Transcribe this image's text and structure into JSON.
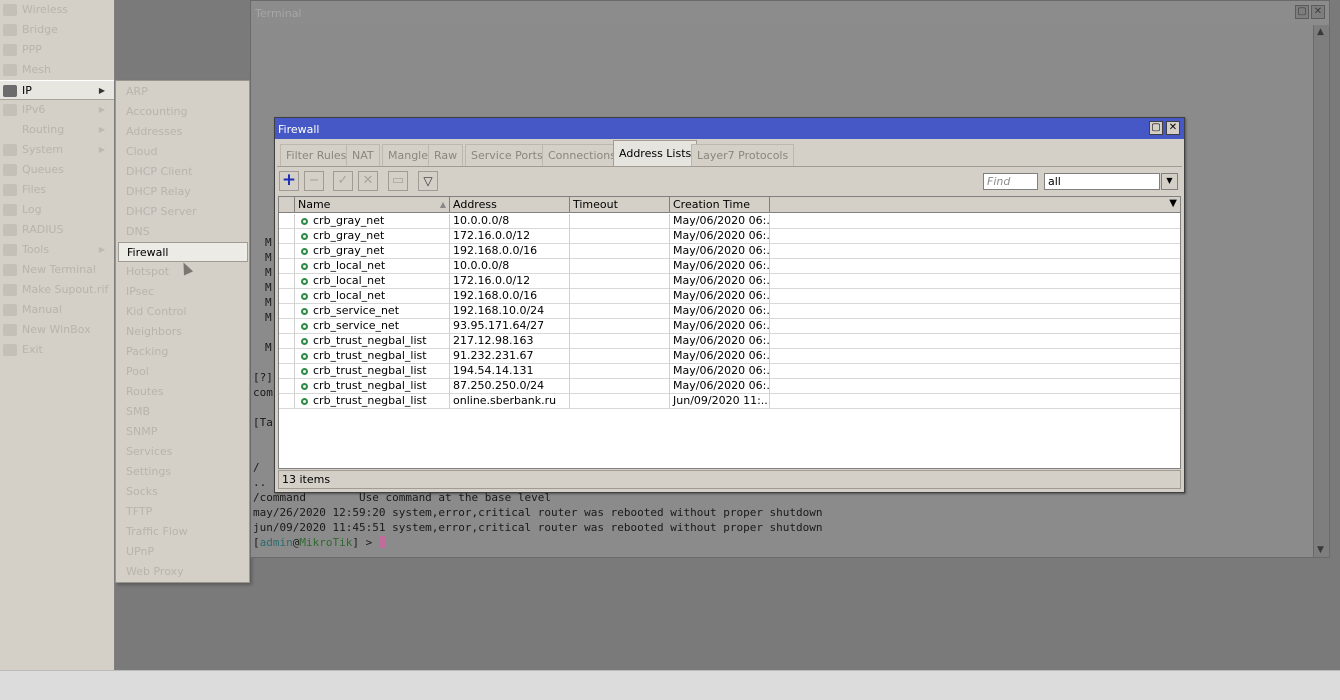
{
  "sidebar": {
    "items": [
      {
        "label": "Wireless",
        "icon": "wireless-icon",
        "arrow": false,
        "active": false
      },
      {
        "label": "Bridge",
        "icon": "bridge-icon",
        "arrow": false,
        "active": false
      },
      {
        "label": "PPP",
        "icon": "ppp-icon",
        "arrow": false,
        "active": false
      },
      {
        "label": "Mesh",
        "icon": "mesh-icon",
        "arrow": false,
        "active": false
      },
      {
        "label": "IP",
        "icon": "ip-icon",
        "arrow": true,
        "active": true
      },
      {
        "label": "IPv6",
        "icon": "ipv6-icon",
        "arrow": true,
        "active": false
      },
      {
        "label": "Routing",
        "icon": "",
        "arrow": true,
        "active": false
      },
      {
        "label": "System",
        "icon": "system-icon",
        "arrow": true,
        "active": false
      },
      {
        "label": "Queues",
        "icon": "queues-icon",
        "arrow": false,
        "active": false
      },
      {
        "label": "Files",
        "icon": "files-icon",
        "arrow": false,
        "active": false
      },
      {
        "label": "Log",
        "icon": "log-icon",
        "arrow": false,
        "active": false
      },
      {
        "label": "RADIUS",
        "icon": "radius-icon",
        "arrow": false,
        "active": false
      },
      {
        "label": "Tools",
        "icon": "tools-icon",
        "arrow": true,
        "active": false
      },
      {
        "label": "New Terminal",
        "icon": "terminal-icon",
        "arrow": false,
        "active": false
      },
      {
        "label": "Make Supout.rif",
        "icon": "supout-icon",
        "arrow": false,
        "active": false
      },
      {
        "label": "Manual",
        "icon": "manual-icon",
        "arrow": false,
        "active": false
      },
      {
        "label": "New WinBox",
        "icon": "winbox-icon",
        "arrow": false,
        "active": false
      },
      {
        "label": "Exit",
        "icon": "exit-icon",
        "arrow": false,
        "active": false
      }
    ]
  },
  "submenu": {
    "items": [
      "ARP",
      "Accounting",
      "Addresses",
      "Cloud",
      "DHCP Client",
      "DHCP Relay",
      "DHCP Server",
      "DNS",
      "Firewall",
      "Hotspot",
      "IPsec",
      "Kid Control",
      "Neighbors",
      "Packing",
      "Pool",
      "Routes",
      "SMB",
      "SNMP",
      "Services",
      "Settings",
      "Socks",
      "TFTP",
      "Traffic Flow",
      "UPnP",
      "Web Proxy"
    ],
    "active": "Firewall"
  },
  "terminal": {
    "title": "Terminal",
    "side_chars": [
      "M",
      "M",
      "M",
      "M",
      "M",
      "M",
      "M"
    ],
    "fragments": [
      "[?]",
      "com",
      "[Ta",
      "/",
      ".."
    ],
    "lines": [
      "/command        Use command at the base level",
      "may/26/2020 12:59:20 system,error,critical router was rebooted without proper shutdown",
      "jun/09/2020 11:45:51 system,error,critical router was rebooted without proper shutdown"
    ],
    "prompt": {
      "open": "[",
      "user": "admin",
      "at": "@",
      "host": "MikroTik",
      "close": "] > "
    }
  },
  "firewall": {
    "title": "Firewall",
    "tabs": [
      "Filter Rules",
      "NAT",
      "Mangle",
      "Raw",
      "Service Ports",
      "Connections",
      "Address Lists",
      "Layer7 Protocols"
    ],
    "active_tab": "Address Lists",
    "toolbar": {
      "find_placeholder": "Find",
      "filter_value": "all"
    },
    "columns": [
      "Name",
      "Address",
      "Timeout",
      "Creation Time"
    ],
    "rows": [
      {
        "name": "crb_gray_net",
        "address": "10.0.0.0/8",
        "timeout": "",
        "created": "May/06/2020 06:..."
      },
      {
        "name": "crb_gray_net",
        "address": "172.16.0.0/12",
        "timeout": "",
        "created": "May/06/2020 06:..."
      },
      {
        "name": "crb_gray_net",
        "address": "192.168.0.0/16",
        "timeout": "",
        "created": "May/06/2020 06:..."
      },
      {
        "name": "crb_local_net",
        "address": "10.0.0.0/8",
        "timeout": "",
        "created": "May/06/2020 06:..."
      },
      {
        "name": "crb_local_net",
        "address": "172.16.0.0/12",
        "timeout": "",
        "created": "May/06/2020 06:..."
      },
      {
        "name": "crb_local_net",
        "address": "192.168.0.0/16",
        "timeout": "",
        "created": "May/06/2020 06:..."
      },
      {
        "name": "crb_service_net",
        "address": "192.168.10.0/24",
        "timeout": "",
        "created": "May/06/2020 06:..."
      },
      {
        "name": "crb_service_net",
        "address": "93.95.171.64/27",
        "timeout": "",
        "created": "May/06/2020 06:..."
      },
      {
        "name": "crb_trust_negbal_list",
        "address": "217.12.98.163",
        "timeout": "",
        "created": "May/06/2020 06:..."
      },
      {
        "name": "crb_trust_negbal_list",
        "address": "91.232.231.67",
        "timeout": "",
        "created": "May/06/2020 06:..."
      },
      {
        "name": "crb_trust_negbal_list",
        "address": "194.54.14.131",
        "timeout": "",
        "created": "May/06/2020 06:..."
      },
      {
        "name": "crb_trust_negbal_list",
        "address": "87.250.250.0/24",
        "timeout": "",
        "created": "May/06/2020 06:..."
      },
      {
        "name": "crb_trust_negbal_list",
        "address": "online.sberbank.ru",
        "timeout": "",
        "created": "Jun/09/2020 11:..."
      }
    ],
    "status": "13 items"
  }
}
